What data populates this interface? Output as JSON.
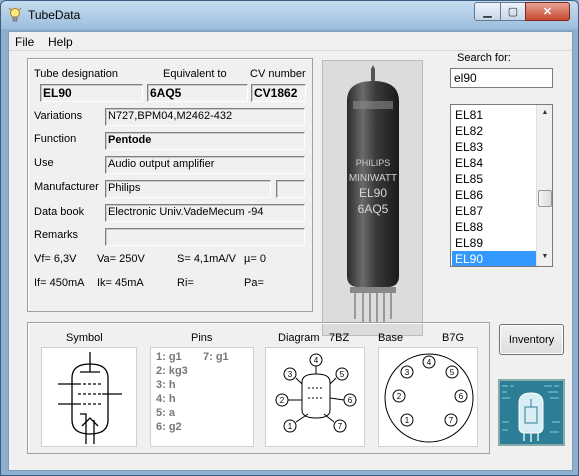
{
  "window": {
    "title": "TubeData"
  },
  "menu": {
    "file": "File",
    "help": "Help"
  },
  "details": {
    "tube_designation_label": "Tube designation",
    "equivalent_label": "Equivalent to",
    "cv_label": "CV number",
    "tube_designation": "EL90",
    "equivalent": "6AQ5",
    "cv_number": "CV1862",
    "variations_label": "Variations",
    "variations": "N727,BPM04,M2462-432",
    "function_label": "Function",
    "function": "Pentode",
    "use_label": "Use",
    "use": "Audio output amplifier",
    "manufacturer_label": "Manufacturer",
    "manufacturer": "Philips",
    "data_book_label": "Data book",
    "data_book": "Electronic Univ.VadeMecum -94",
    "remarks_label": "Remarks",
    "remarks": "",
    "vf": "Vf= 6,3V",
    "va": "Va=  250V",
    "s": "S= 4,1mA/V",
    "mu": "µ=    0",
    "if": "If= 450mA",
    "ik": "Ik=   45mA",
    "ri": "Ri=",
    "pa": "Pa="
  },
  "search": {
    "label": "Search for:",
    "value": "el90"
  },
  "tube_list": [
    {
      "name": "EL81"
    },
    {
      "name": "EL82"
    },
    {
      "name": "EL83"
    },
    {
      "name": "EL84"
    },
    {
      "name": "EL85"
    },
    {
      "name": "EL86"
    },
    {
      "name": "EL87"
    },
    {
      "name": "EL88"
    },
    {
      "name": "EL89"
    },
    {
      "name": "EL90"
    }
  ],
  "selected_tube": "EL90",
  "inventory_button": "Inventory",
  "bottom": {
    "symbol_label": "Symbol",
    "pins_label": "Pins",
    "diagram_label": "Diagram",
    "diagram_code": "7BZ",
    "base_label": "Base",
    "base_code": "B7G",
    "pins": [
      "1: g1",
      "2: kg3",
      "3: h",
      "4: h",
      "5: a",
      "6: g2"
    ],
    "pin7": "7: g1"
  },
  "photo_text": {
    "brand": "PHILIPS",
    "line2": "MINIWATT",
    "type": "EL90",
    "equiv": "6AQ5"
  },
  "colors": {
    "selection": "#3399ff",
    "titlebar": "#9dbedd",
    "close": "#c44a30"
  }
}
